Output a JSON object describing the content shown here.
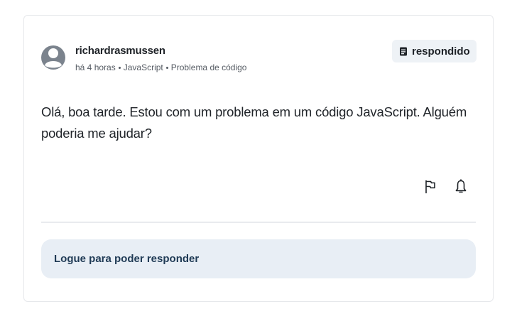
{
  "post": {
    "author": "richardrasmussen",
    "meta": [
      "há 4 horas",
      "JavaScript",
      "Problema de código"
    ],
    "status_badge": {
      "label": "respondido",
      "icon": "document-icon"
    },
    "body": "Olá, boa tarde. Estou com um problema em um código JavaScript. Alguém poderia me ajudar?",
    "actions": [
      {
        "icon": "flag-icon"
      },
      {
        "icon": "bell-icon"
      }
    ],
    "reply_prompt": "Logue para poder responder"
  },
  "colors": {
    "text": "#1f2328",
    "muted": "#555b63",
    "badge_bg": "#eef2f6",
    "reply_bg": "#e8eef5",
    "reply_text": "#1f3a55",
    "avatar": "#7b838d"
  }
}
